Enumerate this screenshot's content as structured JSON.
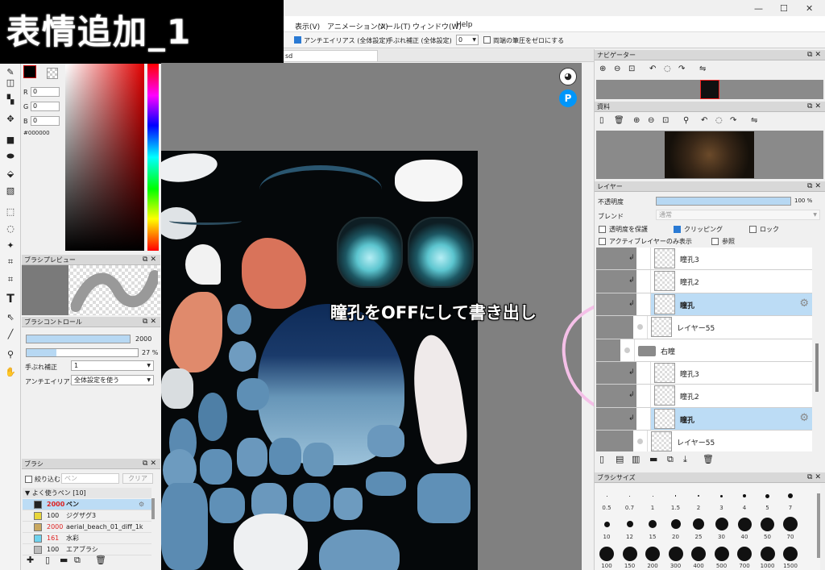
{
  "overlay_title": "表情追加_1",
  "annotation": "瞳孔をOFFにして書き出し",
  "menu": {
    "items": [
      "表示(V)",
      "アニメーション(A)",
      "ツール(T)",
      "ウィンドウ(W)",
      "Help"
    ],
    "partial_left": "ち"
  },
  "toolbar": {
    "antialias_label": "アンチエイリアス (全体設定)",
    "stabilizer_label": "手ぶれ補正 (全体設定)",
    "stabilizer_value": "0",
    "zero_pressure_label": "両端の筆圧をゼロにする"
  },
  "doc_tab": {
    "partial": "sd"
  },
  "color": {
    "r_label": "R",
    "r": "0",
    "g_label": "G",
    "g": "0",
    "b_label": "B",
    "b": "0",
    "hex": "#000000"
  },
  "brush_preview": {
    "title": "ブラシプレビュー"
  },
  "brush_control": {
    "title": "ブラシコントロール",
    "size": "2000",
    "opacity": "27 %",
    "opacity_fraction": 0.27,
    "stabilizer_label": "手ぶれ補正",
    "stabilizer_value": "1",
    "antialias_label": "アンチエイリアス",
    "antialias_value": "全体設定を使う"
  },
  "brush_panel": {
    "title": "ブラシ",
    "filter_label": "絞り込む",
    "filter_placeholder": "ペン",
    "clear_label": "クリア",
    "group": "▼ よく使うペン [10]",
    "items": [
      {
        "size": "2000",
        "name": "ペン",
        "color": "#222222",
        "selected": true
      },
      {
        "size": "100",
        "name": "ジグザグ3",
        "color": "#e8d63a",
        "selected": false
      },
      {
        "size": "2000",
        "name": "aerial_beach_01_diff_1k",
        "color": "#c9a860",
        "selected": false
      },
      {
        "size": "161",
        "name": "水彩",
        "color": "#6fd2ee",
        "selected": false
      },
      {
        "size": "100",
        "name": "エアブラシ",
        "color": "#bbbbbb",
        "selected": false
      }
    ]
  },
  "navigator": {
    "title": "ナビゲーター"
  },
  "reference": {
    "title": "資料"
  },
  "layer_panel": {
    "title": "レイヤー",
    "opacity_label": "不透明度",
    "opacity_value": "100 %",
    "blend_label": "ブレンド",
    "blend_value": "通常",
    "protect_alpha": "透明度を保護",
    "clipping": "クリッピング",
    "lock": "ロック",
    "active_only": "アクティブレイヤーのみ表示",
    "reference": "参照",
    "layers": [
      {
        "name": "瞳孔3",
        "selected": false,
        "clip": true
      },
      {
        "name": "瞳孔2",
        "selected": false,
        "clip": true
      },
      {
        "name": "瞳孔",
        "selected": true,
        "clip": true
      },
      {
        "name": "レイヤー55",
        "selected": false,
        "clip": false
      },
      {
        "name": "右瞳",
        "selected": false,
        "clip": false,
        "folder": true
      },
      {
        "name": "瞳孔3",
        "selected": false,
        "clip": true
      },
      {
        "name": "瞳孔2",
        "selected": false,
        "clip": true
      },
      {
        "name": "瞳孔",
        "selected": true,
        "clip": true
      },
      {
        "name": "レイヤー55",
        "selected": false,
        "clip": false
      }
    ]
  },
  "brush_size": {
    "title": "ブラシサイズ",
    "sizes": [
      "0.5",
      "0.7",
      "1",
      "1.5",
      "2",
      "3",
      "4",
      "5",
      "7",
      "10",
      "12",
      "15",
      "20",
      "25",
      "30",
      "40",
      "50",
      "70",
      "100",
      "150",
      "200",
      "300",
      "400",
      "500",
      "700",
      "1000",
      "1500"
    ]
  },
  "colors": {
    "canvas_bg": "#808080",
    "selection": "#bcdcf5",
    "accent": "#2a7ad4"
  }
}
